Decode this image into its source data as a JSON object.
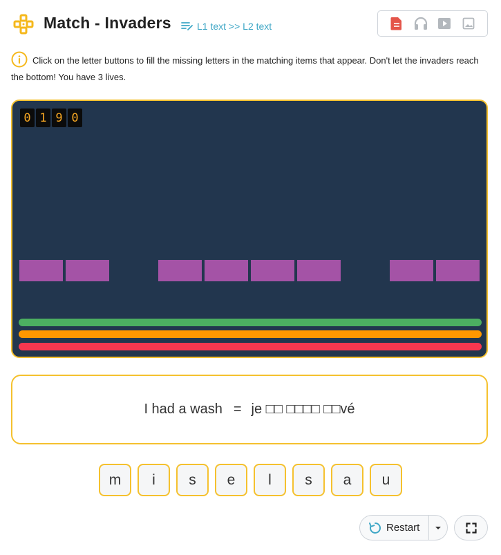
{
  "header": {
    "title": "Match - Invaders",
    "language_direction": "L1 text >> L2 text",
    "logo_icon": "gamepad-icon",
    "media_icons": [
      "document-icon",
      "headphones-icon",
      "video-icon",
      "image-icon"
    ]
  },
  "instructions": "Click on the letter buttons to fill the missing letters in the matching items that appear. Don't let the invaders reach the bottom! You have 3 lives.",
  "game": {
    "score_digits": [
      "0",
      "1",
      "9",
      "0"
    ],
    "invader_color": "#a453a6",
    "invaders_present": [
      true,
      true,
      false,
      true,
      true,
      true,
      true,
      false,
      true,
      true
    ],
    "lives": 3,
    "life_colors": [
      "#4caf61",
      "#ff9800",
      "#f7374f"
    ],
    "board_bg": "#22364e",
    "accent": "#f5c12e"
  },
  "word": {
    "l1": "I had a wash",
    "equals": "=",
    "l2": "je □□ □□□□ □□vé"
  },
  "letters": [
    "m",
    "i",
    "s",
    "e",
    "l",
    "s",
    "a",
    "u"
  ],
  "controls": {
    "restart_label": "Restart",
    "restart_icon": "restart-icon",
    "dropdown_icon": "caret-down-icon",
    "fullscreen_icon": "fullscreen-icon"
  }
}
